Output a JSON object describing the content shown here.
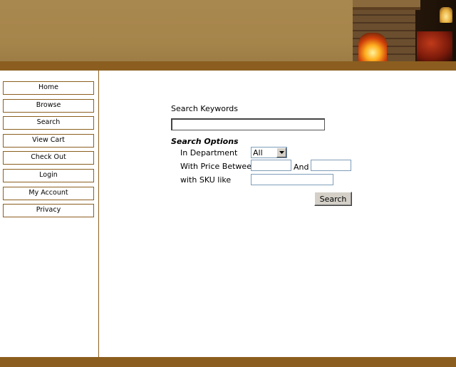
{
  "nav": {
    "items": [
      {
        "label": "Home"
      },
      {
        "label": "Browse"
      },
      {
        "label": "Search"
      },
      {
        "label": "View Cart"
      },
      {
        "label": "Check Out"
      },
      {
        "label": "Login"
      },
      {
        "label": "My Account"
      },
      {
        "label": "Privacy"
      }
    ]
  },
  "search": {
    "keywords_label": "Search Keywords",
    "keywords_value": "",
    "options_heading": "Search Options",
    "department_label": "In Department",
    "department_selected": "All",
    "price_label": "With Price Between",
    "price_min_value": "",
    "price_and_label": "And",
    "price_max_value": "",
    "sku_label": "with SKU like",
    "sku_value": "",
    "submit_label": "Search"
  },
  "colors": {
    "header": "#a6854b",
    "accent_bar": "#8b5e1f",
    "nav_border": "#8b5e1f"
  },
  "icons": {
    "header_image": "fireplace-lodge-photo",
    "select_arrow": "chevron-down-icon"
  }
}
